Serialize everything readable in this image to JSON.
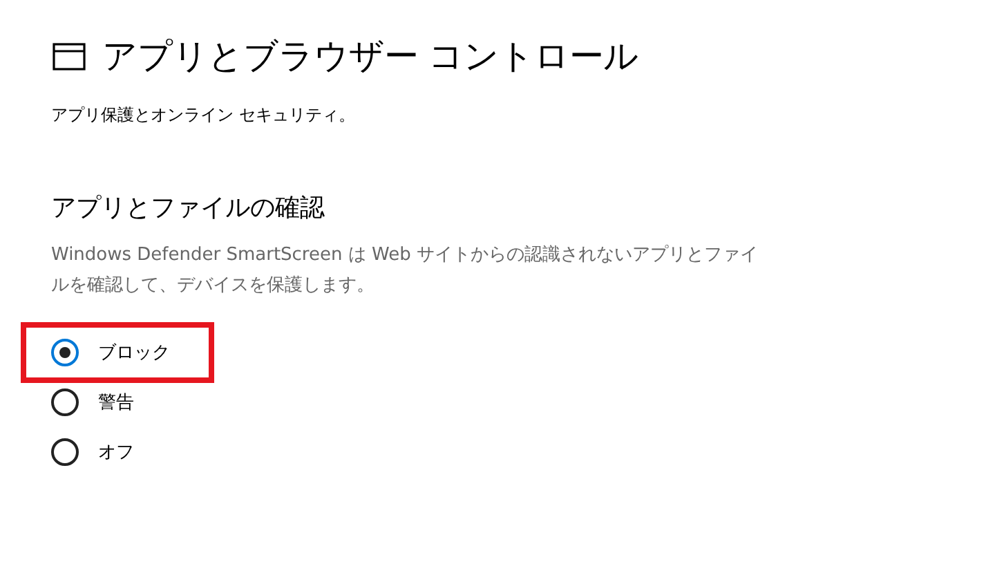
{
  "page": {
    "title": "アプリとブラウザー コントロール",
    "subtitle": "アプリ保護とオンライン セキュリティ。"
  },
  "section": {
    "heading": "アプリとファイルの確認",
    "description": "Windows Defender SmartScreen は Web サイトからの認識されないアプリとファイルを確認して、デバイスを保護します。"
  },
  "options": [
    {
      "label": "ブロック",
      "selected": true,
      "highlighted": true
    },
    {
      "label": "警告",
      "selected": false,
      "highlighted": false
    },
    {
      "label": "オフ",
      "selected": false,
      "highlighted": false
    }
  ]
}
